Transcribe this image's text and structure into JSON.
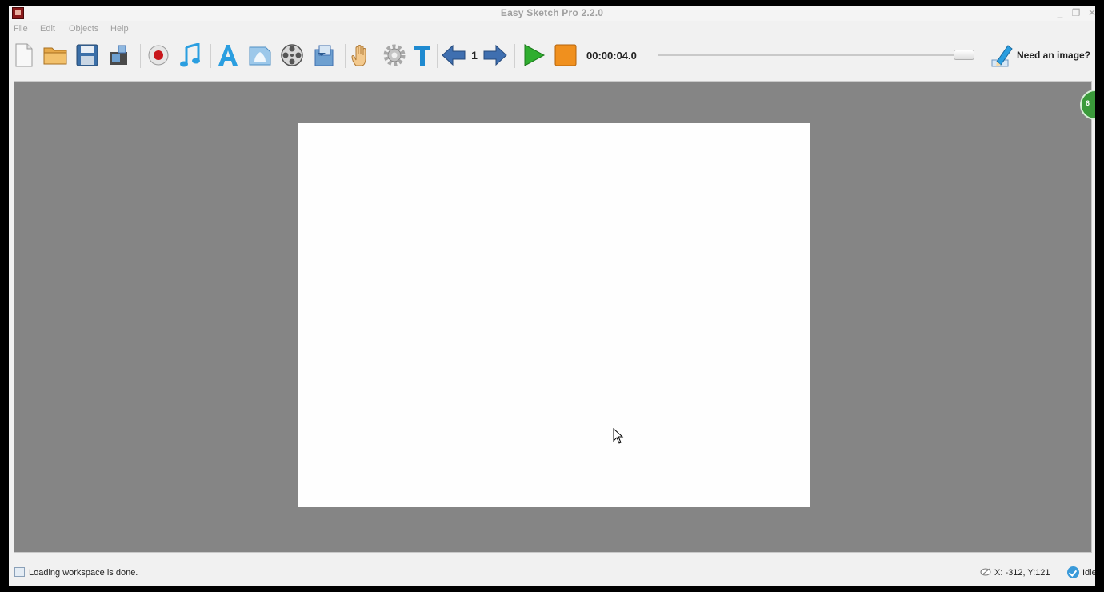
{
  "window": {
    "title": "Easy Sketch Pro 2.2.0",
    "controls": {
      "minimize": "_",
      "restore": "❐",
      "close": "✕"
    }
  },
  "menu": {
    "items": [
      "File",
      "Edit",
      "Objects",
      "Help"
    ]
  },
  "toolbar": {
    "buttons": [
      {
        "name": "new-document-icon"
      },
      {
        "name": "open-folder-icon"
      },
      {
        "name": "save-disk-icon"
      },
      {
        "name": "export-icon"
      },
      {
        "name": "record-icon"
      },
      {
        "name": "music-note-icon"
      },
      {
        "name": "text-a-icon"
      },
      {
        "name": "image-icon"
      },
      {
        "name": "film-reel-icon"
      },
      {
        "name": "slides-icon"
      },
      {
        "name": "hand-icon"
      },
      {
        "name": "gear-icon"
      },
      {
        "name": "text-t-icon"
      },
      {
        "name": "arrow-left-icon"
      },
      {
        "name": "arrow-right-icon"
      },
      {
        "name": "play-icon"
      },
      {
        "name": "stop-icon"
      },
      {
        "name": "pencil-image-icon"
      }
    ],
    "page_number": "1",
    "time": "00:00:04.0",
    "timeline_position": 0.95,
    "need_image_label": "Need an image?"
  },
  "colors": {
    "workspace": "#858585",
    "canvas": "#fefefe",
    "play": "#2fae2f",
    "stop": "#f0901e",
    "arrow": "#3f6fb0",
    "accent_blue": "#2a9ee0"
  },
  "status": {
    "message": "Loading workspace is done.",
    "coords": "X: -312, Y:121",
    "state": "Idle"
  }
}
